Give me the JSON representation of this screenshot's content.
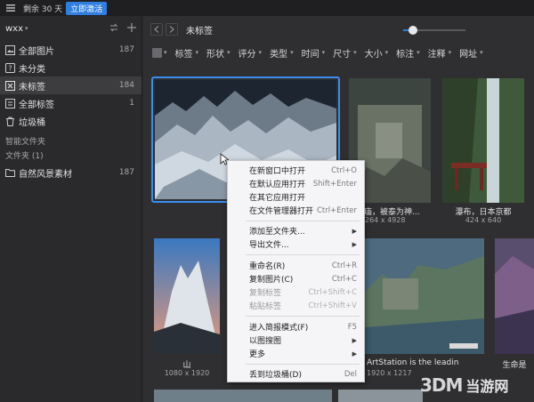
{
  "topbar": {
    "trial_text": "剩余 30 天",
    "activate_label": "立即激活"
  },
  "sidebar": {
    "library_name": "wxx",
    "items": [
      {
        "label": "全部图片",
        "count": "187",
        "icon": "images-icon"
      },
      {
        "label": "未分类",
        "count": "",
        "icon": "question-icon"
      },
      {
        "label": "未标签",
        "count": "184",
        "icon": "tag-icon"
      },
      {
        "label": "全部标签",
        "count": "1",
        "icon": "tags-icon"
      },
      {
        "label": "垃圾桶",
        "count": "",
        "icon": "trash-icon"
      }
    ],
    "smart_folders_label": "智能文件夹",
    "folders_label": "文件夹 (1)",
    "folder": {
      "label": "自然风景素材",
      "count": "187"
    }
  },
  "main": {
    "page_title": "未标签",
    "zoom_level": 0.15,
    "filters": [
      "标签",
      "形状",
      "评分",
      "类型",
      "时间",
      "尺寸",
      "大小",
      "标注",
      "注释",
      "网址"
    ]
  },
  "grid": {
    "items": [
      {
        "caption": "",
        "dims": ""
      },
      {
        "caption": "高庙，被泰为神...",
        "dims": "264 x 4928"
      },
      {
        "caption": "瀑布，日本京都",
        "dims": "424 x 640"
      },
      {
        "caption": "山",
        "dims": "1080 x 1920"
      },
      {
        "caption": "ArtStation is the leadin",
        "dims": "1920 x 1217"
      },
      {
        "caption": "生命是",
        "dims": ""
      }
    ]
  },
  "context_menu": {
    "groups": [
      [
        {
          "label": "在新窗口中打开",
          "shortcut": "Ctrl+O",
          "enabled": true,
          "submenu": false
        },
        {
          "label": "在默认应用打开",
          "shortcut": "Shift+Enter",
          "enabled": true,
          "submenu": false
        },
        {
          "label": "在其它应用打开",
          "shortcut": "",
          "enabled": true,
          "submenu": false
        },
        {
          "label": "在文件管理器打开",
          "shortcut": "Ctrl+Enter",
          "enabled": true,
          "submenu": false
        }
      ],
      [
        {
          "label": "添加至文件夹...",
          "shortcut": "",
          "enabled": true,
          "submenu": true
        },
        {
          "label": "导出文件...",
          "shortcut": "",
          "enabled": true,
          "submenu": true
        }
      ],
      [
        {
          "label": "重命名(R)",
          "shortcut": "Ctrl+R",
          "enabled": true,
          "submenu": false
        },
        {
          "label": "复制图片(C)",
          "shortcut": "Ctrl+C",
          "enabled": true,
          "submenu": false
        },
        {
          "label": "复制标签",
          "shortcut": "Ctrl+Shift+C",
          "enabled": false,
          "submenu": false
        },
        {
          "label": "粘贴标签",
          "shortcut": "Ctrl+Shift+V",
          "enabled": false,
          "submenu": false
        }
      ],
      [
        {
          "label": "进入简报模式(F)",
          "shortcut": "F5",
          "enabled": true,
          "submenu": false
        },
        {
          "label": "以图搜图",
          "shortcut": "",
          "enabled": true,
          "submenu": true
        },
        {
          "label": "更多",
          "shortcut": "",
          "enabled": true,
          "submenu": true
        }
      ],
      [
        {
          "label": "丢到垃圾桶(D)",
          "shortcut": "Del",
          "enabled": true,
          "submenu": false
        }
      ]
    ]
  },
  "watermark": {
    "text": "当游网"
  },
  "colors": {
    "accent": "#2f7ee0",
    "selection": "#3a8ef0"
  }
}
